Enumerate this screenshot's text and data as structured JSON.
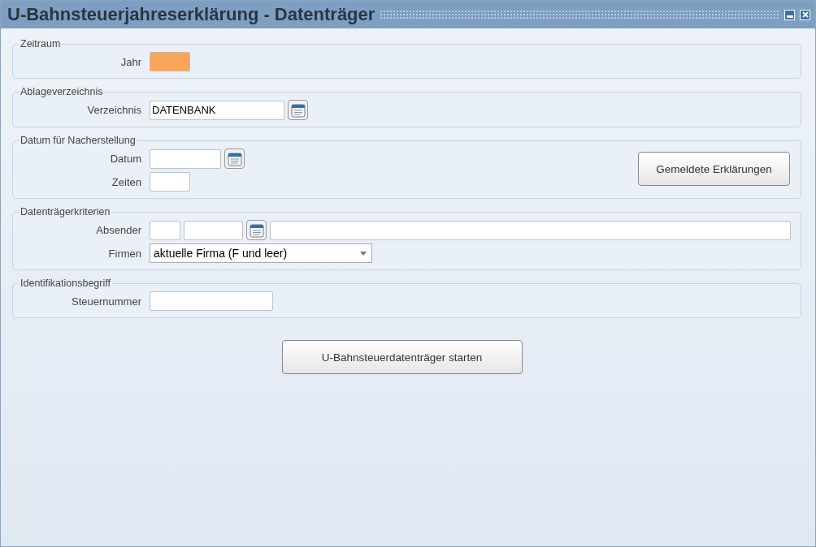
{
  "window": {
    "title": "U-Bahnsteuerjahreserklärung - Datenträger"
  },
  "groups": [
    {
      "title": "Zeitraum",
      "rows": [
        {
          "label": "Jahr",
          "fields": [
            {
              "kind": "text",
              "highlighted": true
            }
          ]
        }
      ]
    },
    {
      "title": "Ablageverzeichnis",
      "rows": [
        {
          "label": "Verzeichnis",
          "fields": [
            {
              "kind": "text",
              "value": "DATENBANK",
              "highlighted": false
            },
            {
              "kind": "picker"
            }
          ]
        }
      ]
    },
    {
      "title": "Datum für Nacherstellung",
      "button": "Gemeldete Erklärungen",
      "rows": [
        {
          "label": "Datum",
          "fields": [
            {
              "kind": "text",
              "highlighted": false
            },
            {
              "kind": "picker"
            }
          ]
        },
        {
          "label": "Zeiten",
          "fields": [
            {
              "kind": "text",
              "highlighted": false
            }
          ]
        }
      ]
    },
    {
      "title": "Datenträgerkriterien",
      "rows": [
        {
          "label": "Absender",
          "fields": [
            {
              "kind": "text",
              "highlighted": false
            },
            {
              "kind": "text",
              "highlighted": false
            },
            {
              "kind": "picker"
            },
            {
              "kind": "text",
              "highlighted": false
            }
          ]
        },
        {
          "label": "Firmen",
          "fields": [
            {
              "kind": "select",
              "value": "aktuelle Firma (F und leer)"
            }
          ]
        }
      ]
    },
    {
      "title": "Identifikationsbegriff",
      "rows": [
        {
          "label": "Steuernummer",
          "fields": [
            {
              "kind": "text",
              "highlighted": false
            }
          ]
        }
      ]
    }
  ],
  "start_button": "U-Bahnsteuerdatenträger starten"
}
